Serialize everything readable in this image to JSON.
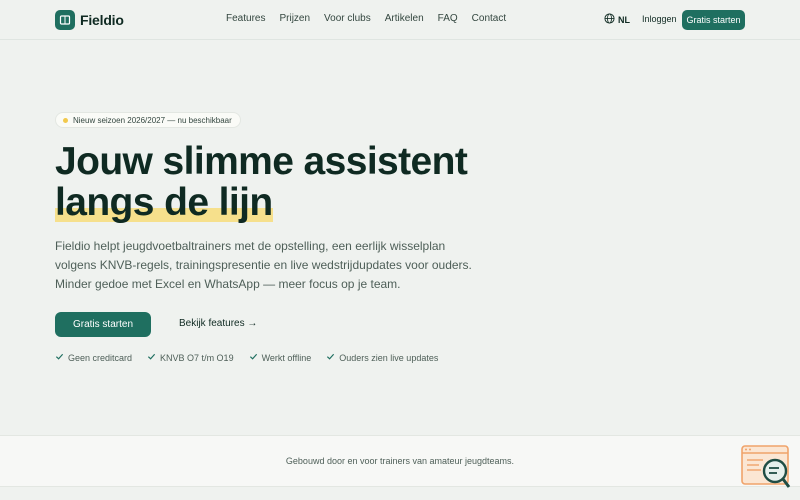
{
  "brand": {
    "name": "Fieldio",
    "color": "#1f6f60",
    "highlight": "#f6e08c"
  },
  "nav": {
    "items": [
      "Features",
      "Prijzen",
      "Voor clubs",
      "Artikelen",
      "FAQ",
      "Contact"
    ],
    "language": "NL",
    "language_icon": "globe-icon",
    "login": "Inloggen",
    "cta": "Gratis starten"
  },
  "hero": {
    "badge": "Nieuw seizoen 2026/2027 — nu beschikbaar",
    "headline_line1": "Jouw slimme assistent",
    "headline_line2": "langs de lijn",
    "lead": "Fieldio helpt jeugdvoetbaltrainers met de opstelling, een eerlijk wisselplan volgens KNVB-regels, trainingspresentie en live wedstrijdupdates voor ouders. Minder gedoe met Excel en WhatsApp — meer focus op je team.",
    "primary_cta": "Gratis starten",
    "secondary_cta": "Bekijk features →",
    "checks": [
      "Geen creditcard",
      "KNVB O7 t/m O19",
      "Werkt offline",
      "Ouders zien live updates"
    ]
  },
  "strip": {
    "text": "Gebouwd door en voor trainers van amateur jeugdteams."
  },
  "widget": {
    "icon": "search-document-icon"
  }
}
